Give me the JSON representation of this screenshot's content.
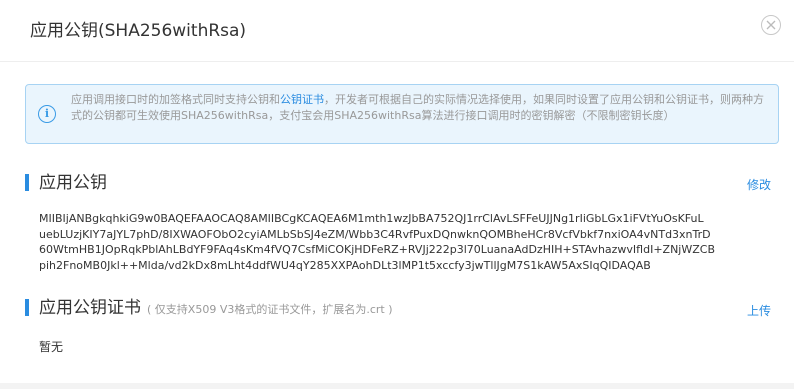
{
  "dialog": {
    "title": "应用公钥(SHA256withRsa)"
  },
  "info": {
    "text_before": "应用调用接口时的加签格式同时支持公钥和",
    "link": "公钥证书",
    "text_after": "，开发者可根据自己的实际情况选择使用，如果同时设置了应用公钥和公钥证书，则两种方式的公钥都可生效使用SHA256withRsa，支付宝会用SHA256withRsa算法进行接口调用时的密钥解密（不限制密钥长度）"
  },
  "public_key_section": {
    "title": "应用公钥",
    "action": "修改",
    "key_lines": [
      "MIIBIjANBgkqhkiG9w0BAQEFAAOCAQ8AMIIBCgKCAQEA6M1mth1wzJbBA752QJ1rrClAvLSFFeUJJNg1rIiGbLGx1iFVtYuOsKFuL",
      "uebLUzjKIY7aJYL7phD/8IXWAOFObO2cyiAMLbSbSJ4eZM/Wbb3C4RvfPuxDQnwknQOMBheHCr8VcfVbkf7nxiOA4vNTd3xnTrD",
      "60WtmHB1JOpRqkPblAhLBdYF9FAq4sKm4fVQ7CsfMiCOKjHDFeRZ+RVJj222p3l70LuanaAdDzHIH+STAvhazwvIfldI+ZNjWZCB",
      "pih2FnoMB0Jkl++Mlda/vd2kDx8mLht4ddfWU4qY285XXPAohDLt3lMP1t5xccfy3jwTllJgM7S1kAW5AxSIqQIDAQAB"
    ]
  },
  "cert_section": {
    "title": "应用公钥证书",
    "subtitle": "( 仅支持X509 V3格式的证书文件，扩展名为.crt )",
    "action": "上传",
    "empty_text": "暂无"
  },
  "icons": {
    "close": "close-circle-icon",
    "info": "info-circle-icon"
  },
  "colors": {
    "accent": "#2a8ce0",
    "info_bg": "#eaf5fd",
    "info_border": "#a7d3f3"
  }
}
